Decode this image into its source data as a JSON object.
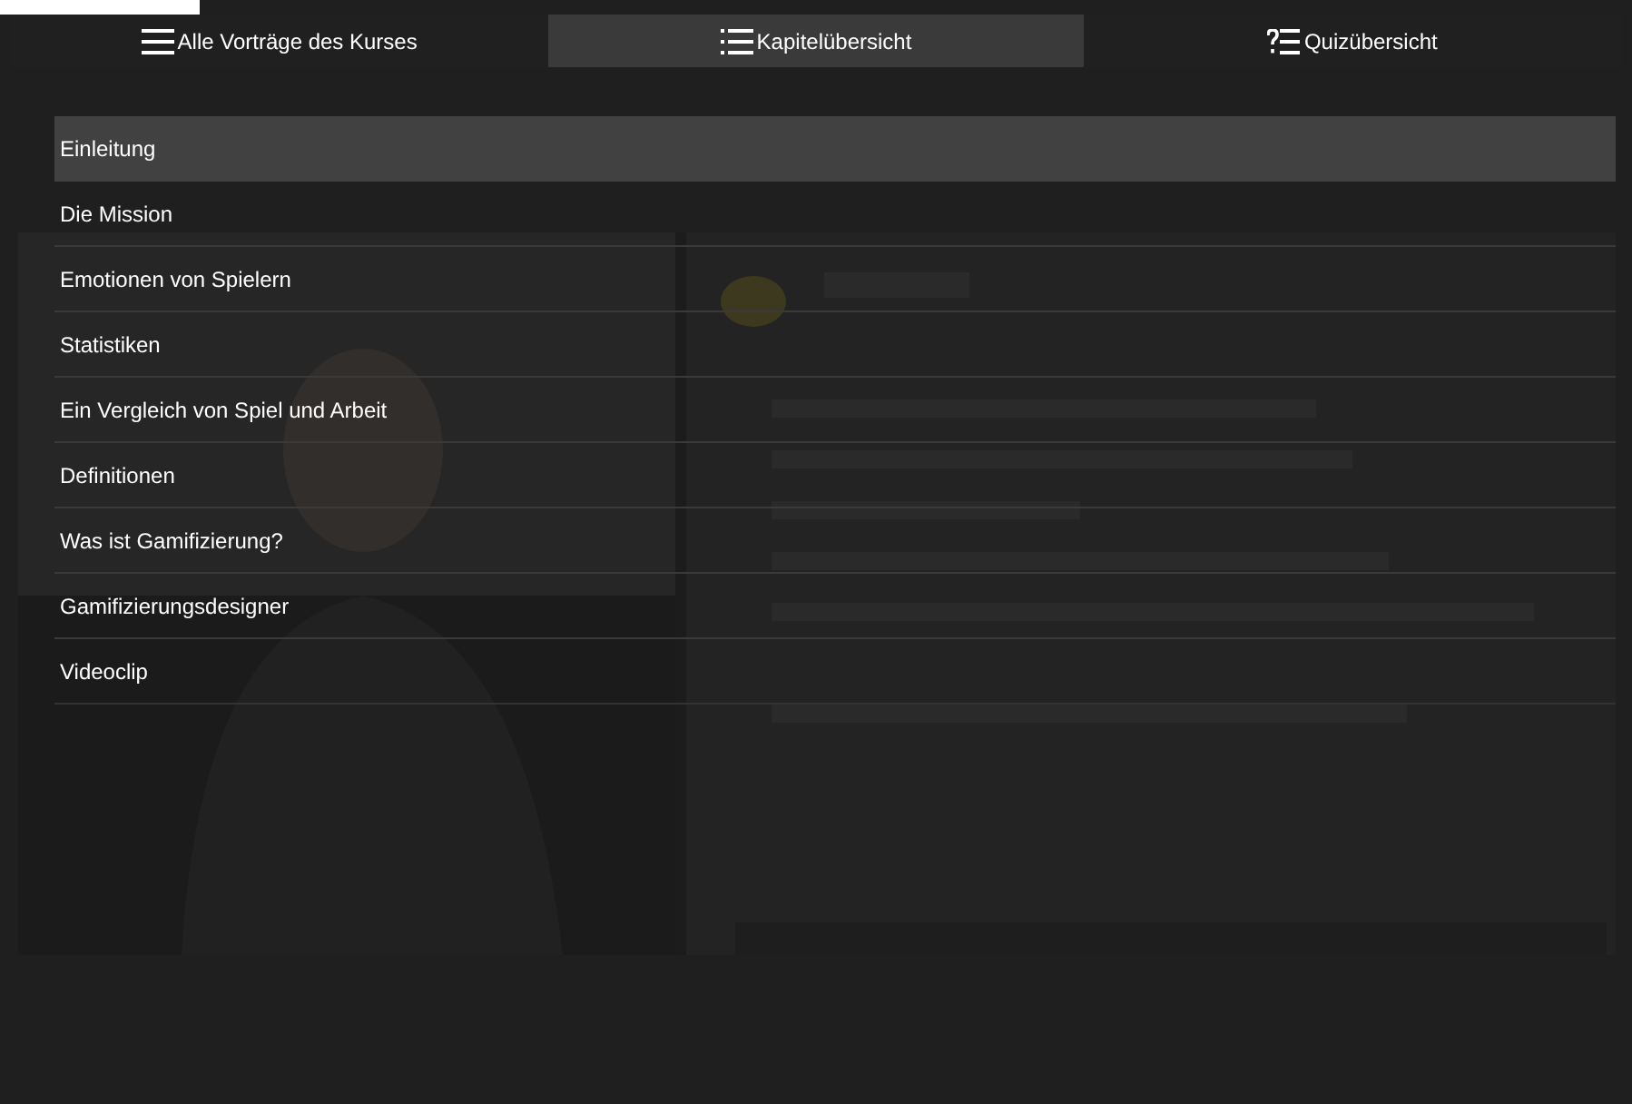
{
  "tabs": [
    {
      "label": "Alle Vorträge des Kurses",
      "kind": "menu",
      "selected": false
    },
    {
      "label": "Kapitelübersicht",
      "kind": "list",
      "selected": true
    },
    {
      "label": "Quizübersicht",
      "kind": "quiz",
      "selected": false
    }
  ],
  "chapters": [
    {
      "label": "Einleitung",
      "selected": true
    },
    {
      "label": "Die Mission",
      "selected": false
    },
    {
      "label": "Emotionen von Spielern",
      "selected": false
    },
    {
      "label": "Statistiken",
      "selected": false
    },
    {
      "label": "Ein Vergleich von Spiel und Arbeit",
      "selected": false
    },
    {
      "label": "Definitionen",
      "selected": false
    },
    {
      "label": "Was ist Gamifizierung?",
      "selected": false
    },
    {
      "label": "Gamifizierungsdesigner",
      "selected": false
    },
    {
      "label": "Videoclip",
      "selected": false
    }
  ]
}
